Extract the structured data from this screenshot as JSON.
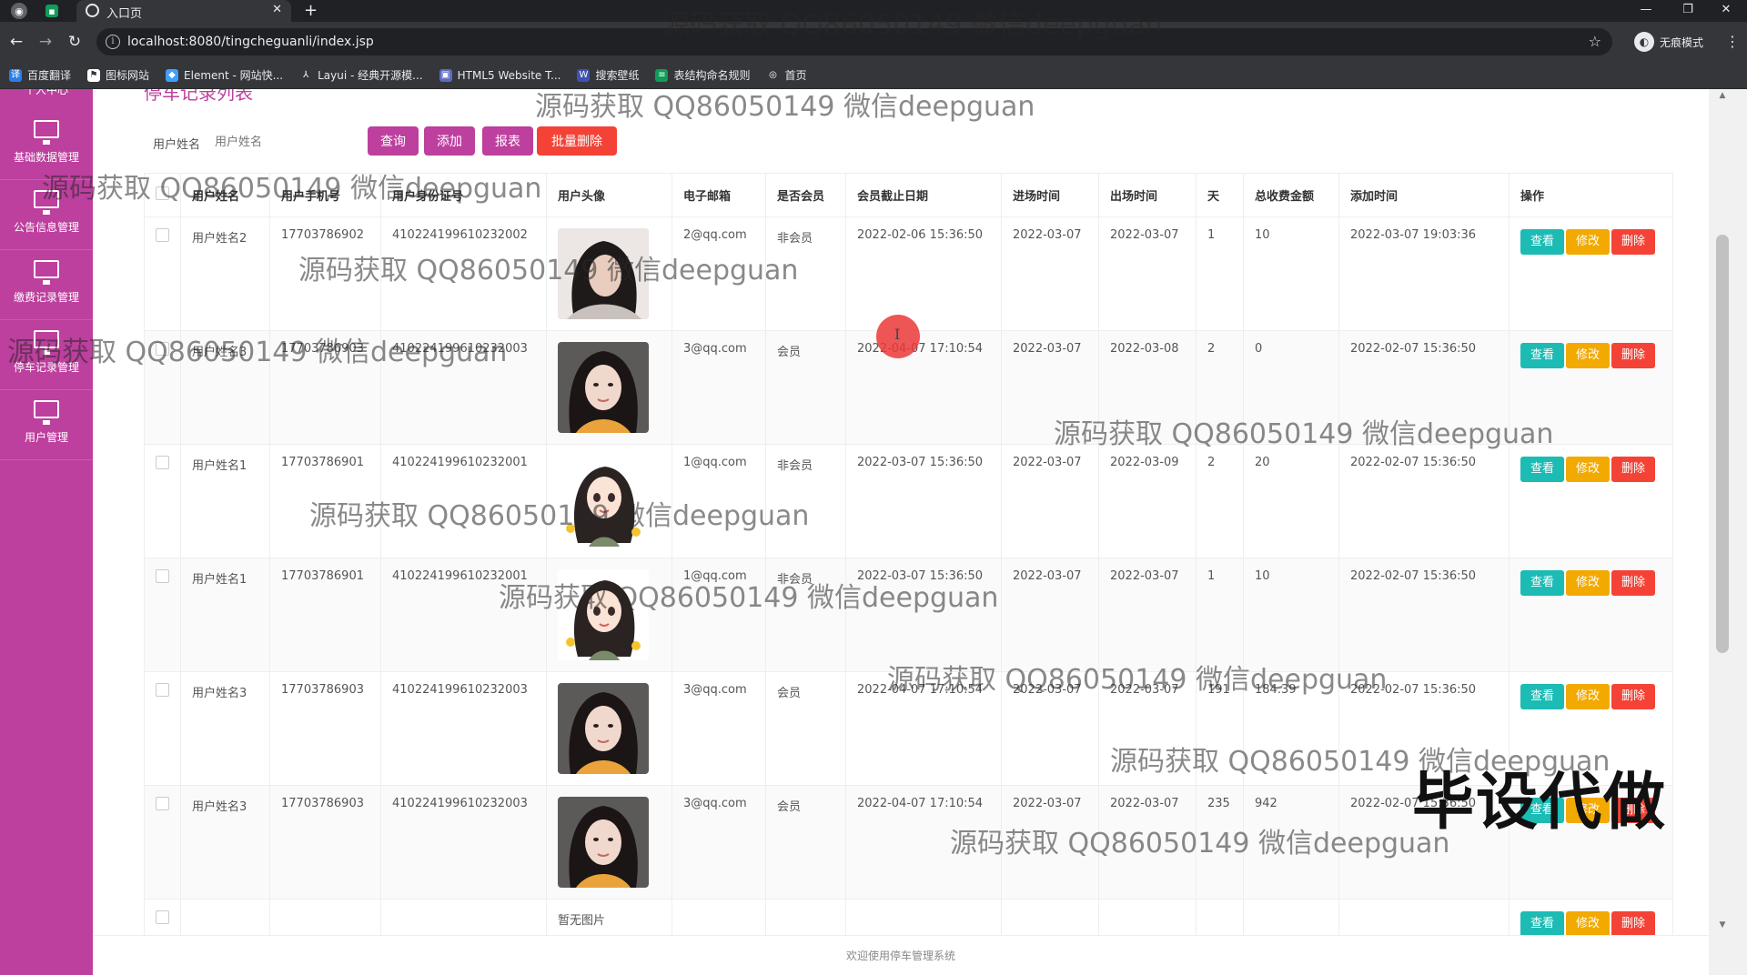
{
  "browser": {
    "tab_title": "入口页",
    "tab_close": "✕",
    "new_tab": "+",
    "url": "localhost:8080/tingcheguanli/index.jsp",
    "profile_label": "无痕模式",
    "window_controls": [
      "—",
      "❐",
      "✕"
    ]
  },
  "bookmarks": [
    {
      "label": "百度翻译",
      "color": "#2b7de9",
      "glyph": "译"
    },
    {
      "label": "图标网站",
      "color": "#ffffff",
      "glyph": "⚑"
    },
    {
      "label": "Element - 网站快...",
      "color": "#409eff",
      "glyph": "◆"
    },
    {
      "label": "Layui - 经典开源模...",
      "color": "#35363a",
      "glyph": "⅄"
    },
    {
      "label": "HTML5 Website T...",
      "color": "#5c6bc0",
      "glyph": "▣"
    },
    {
      "label": "搜索壁纸",
      "color": "#3f51b5",
      "glyph": "W"
    },
    {
      "label": "表结构命名规则",
      "color": "#0f9d58",
      "glyph": "≡"
    },
    {
      "label": "首页",
      "color": "#35363a",
      "glyph": "◎"
    }
  ],
  "sidebar": {
    "top_label": "个人中心",
    "items": [
      {
        "label": "基础数据管理"
      },
      {
        "label": "公告信息管理"
      },
      {
        "label": "缴费记录管理"
      },
      {
        "label": "停车记录管理"
      },
      {
        "label": "用户管理"
      }
    ]
  },
  "page": {
    "title": "停车记录列表",
    "search_label": "用户姓名",
    "search_placeholder": "用户姓名",
    "buttons": {
      "query": "查询",
      "add": "添加",
      "report": "报表",
      "batch_delete": "批量删除"
    },
    "footer": "欢迎使用停车管理系统"
  },
  "colors": {
    "sidebar": "#bd3f9e",
    "btn_magenta": "#bd3f9e",
    "btn_red": "#f44336",
    "view": "#1cbbb4",
    "edit": "#f2a900",
    "delete": "#f44336"
  },
  "table": {
    "headers": [
      "用户姓名",
      "用户手机号",
      "用户身份证号",
      "用户头像",
      "电子邮箱",
      "是否会员",
      "会员截止日期",
      "进场时间",
      "出场时间",
      "天",
      "总收费金额",
      "添加时间",
      "操作"
    ],
    "actions": {
      "view": "查看",
      "edit": "修改",
      "delete": "删除"
    },
    "rows": [
      {
        "name": "用户姓名2",
        "phone": "17703786902",
        "idcard": "410224199610232002",
        "avatar": "photo-dark",
        "email": "2@qq.com",
        "member": "非会员",
        "expire": "2022-02-06 15:36:50",
        "enter": "2022-03-07",
        "exit": "2022-03-07",
        "days": "1",
        "amount": "10",
        "added": "2022-03-07 19:03:36"
      },
      {
        "name": "用户姓名3",
        "phone": "17703786903",
        "idcard": "410224199610232003",
        "avatar": "photo-girl",
        "email": "3@qq.com",
        "member": "会员",
        "expire": "2022-04-07 17:10:54",
        "enter": "2022-03-07",
        "exit": "2022-03-08",
        "days": "2",
        "amount": "0",
        "added": "2022-02-07 15:36:50"
      },
      {
        "name": "用户姓名1",
        "phone": "17703786901",
        "idcard": "410224199610232001",
        "avatar": "cartoon-girl",
        "email": "1@qq.com",
        "member": "非会员",
        "expire": "2022-03-07 15:36:50",
        "enter": "2022-03-07",
        "exit": "2022-03-09",
        "days": "2",
        "amount": "20",
        "added": "2022-02-07 15:36:50"
      },
      {
        "name": "用户姓名1",
        "phone": "17703786901",
        "idcard": "410224199610232001",
        "avatar": "cartoon-girl",
        "email": "1@qq.com",
        "member": "非会员",
        "expire": "2022-03-07 15:36:50",
        "enter": "2022-03-07",
        "exit": "2022-03-07",
        "days": "1",
        "amount": "10",
        "added": "2022-02-07 15:36:50"
      },
      {
        "name": "用户姓名3",
        "phone": "17703786903",
        "idcard": "410224199610232003",
        "avatar": "photo-girl",
        "email": "3@qq.com",
        "member": "会员",
        "expire": "2022-04-07 17:10:54",
        "enter": "2022-03-07",
        "exit": "2022-03-07",
        "days": "191",
        "amount": "184.39",
        "added": "2022-02-07 15:36:50"
      },
      {
        "name": "用户姓名3",
        "phone": "17703786903",
        "idcard": "410224199610232003",
        "avatar": "photo-girl",
        "email": "3@qq.com",
        "member": "会员",
        "expire": "2022-04-07 17:10:54",
        "enter": "2022-03-07",
        "exit": "2022-03-07",
        "days": "235",
        "amount": "942",
        "added": "2022-02-07 15:36:50"
      },
      {
        "name": "",
        "phone": "",
        "idcard": "",
        "avatar": "none",
        "avatar_text": "暂无图片",
        "email": "",
        "member": "",
        "expire": "",
        "enter": "",
        "exit": "",
        "days": "",
        "amount": "",
        "added": ""
      }
    ]
  },
  "watermark": {
    "text": "源码获取 QQ86050149 微信deepguan",
    "big_text": "毕设代做"
  }
}
